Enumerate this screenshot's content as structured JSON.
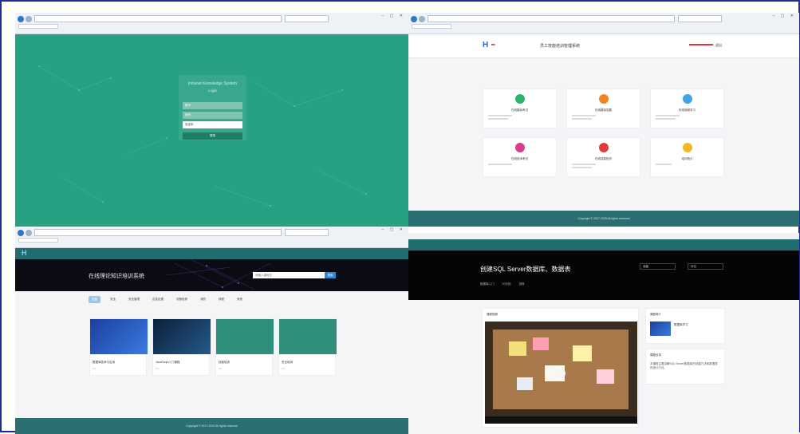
{
  "frame": {
    "border_color": "#1d2c9a"
  },
  "pane1": {
    "login_title": "Intranet Knowledge System",
    "login_subtitle": "Login",
    "username_placeholder": "账号",
    "password_placeholder": "密码",
    "captcha_placeholder": "验证码",
    "login_button": "登录",
    "bg_color": "#27a184"
  },
  "pane2": {
    "system_title": "员工技能培训管理系统",
    "user_label": "退出",
    "cards": [
      {
        "title": "在线模拟考试",
        "color": "#2eb36b"
      },
      {
        "title": "在线模拟答题",
        "color": "#f0861f"
      },
      {
        "title": "在线视频学习",
        "color": "#3ea4e6"
      },
      {
        "title": "在线技术考试",
        "color": "#d73f8e"
      },
      {
        "title": "在线技能知识",
        "color": "#e03b3b"
      },
      {
        "title": "培训统计",
        "color": "#f2b821"
      }
    ],
    "footer": "Copyright © 2017-2020 All rights reserved",
    "footer_color": "#2b6f72"
  },
  "pane3": {
    "banner_title": "在线理论知识培训系统",
    "search_placeholder": "请输入课程名",
    "search_button": "搜索",
    "tabs": [
      "全部",
      "安全",
      "安全管理",
      "应急处置",
      "设备检修",
      "消防",
      "规程",
      "其他"
    ],
    "courses": [
      {
        "name": "数据库技术与应用",
        "meta": "0  0"
      },
      {
        "name": "JavaScript入门课程",
        "meta": "0  0"
      },
      {
        "name": "技能培训",
        "meta": "0  0"
      },
      {
        "name": "安全培训",
        "meta": "0  0"
      }
    ],
    "footer": "Copyright © 2017-2020 All rights reserved"
  },
  "pane4": {
    "banner_title": "创建SQL Server数据库、数据表",
    "banner_sub": [
      "数据库入门",
      "20分钟",
      "讲师"
    ],
    "box1": "收藏",
    "box2": "评论",
    "video_title": "课程视频",
    "side1_title": "课程简介",
    "side1_text": "数据库学习",
    "side2_title": "课程目录",
    "side2_text": "本课程主要讲解SQL Server数据库的创建方法和数据表的设计方法。"
  }
}
